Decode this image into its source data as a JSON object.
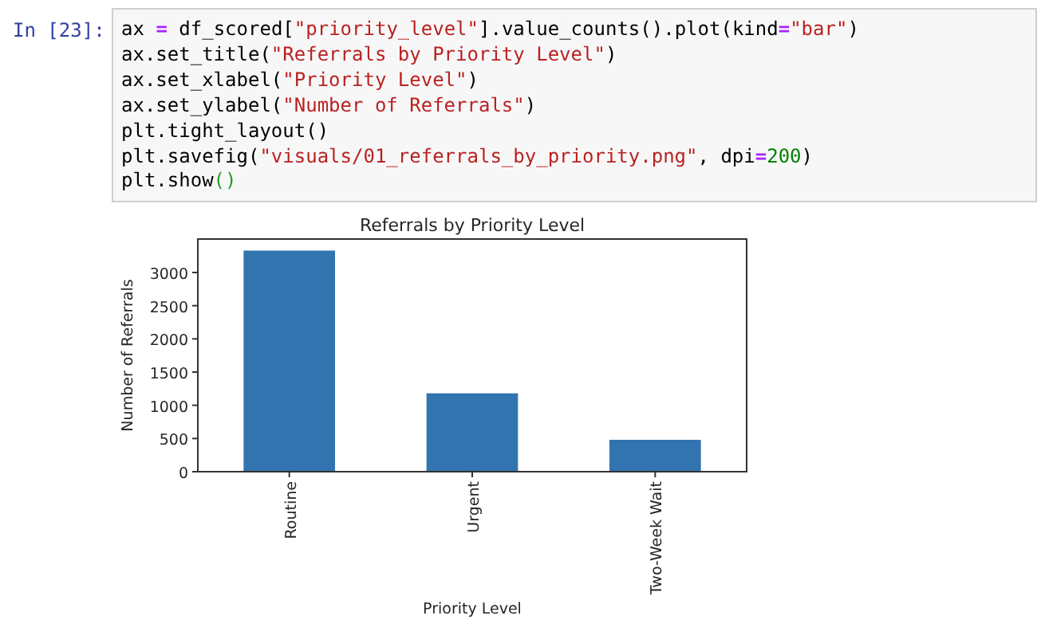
{
  "cell": {
    "prompt": "In [23]:",
    "code": [
      [
        {
          "kind": "plain",
          "text": "ax "
        },
        {
          "kind": "op",
          "text": "="
        },
        {
          "kind": "plain",
          "text": " df_scored["
        },
        {
          "kind": "str",
          "text": "\"priority_level\""
        },
        {
          "kind": "plain",
          "text": "].value_counts().plot(kind"
        },
        {
          "kind": "op",
          "text": "="
        },
        {
          "kind": "str",
          "text": "\"bar\""
        },
        {
          "kind": "plain",
          "text": ")"
        }
      ],
      [
        {
          "kind": "plain",
          "text": "ax.set_title("
        },
        {
          "kind": "str",
          "text": "\"Referrals by Priority Level\""
        },
        {
          "kind": "plain",
          "text": ")"
        }
      ],
      [
        {
          "kind": "plain",
          "text": "ax.set_xlabel("
        },
        {
          "kind": "str",
          "text": "\"Priority Level\""
        },
        {
          "kind": "plain",
          "text": ")"
        }
      ],
      [
        {
          "kind": "plain",
          "text": "ax.set_ylabel("
        },
        {
          "kind": "str",
          "text": "\"Number of Referrals\""
        },
        {
          "kind": "plain",
          "text": ")"
        }
      ],
      [
        {
          "kind": "plain",
          "text": "plt.tight_layout()"
        }
      ],
      [
        {
          "kind": "plain",
          "text": "plt.savefig("
        },
        {
          "kind": "str",
          "text": "\"visuals/01_referrals_by_priority.png\""
        },
        {
          "kind": "plain",
          "text": ", dpi"
        },
        {
          "kind": "op",
          "text": "="
        },
        {
          "kind": "num",
          "text": "200"
        },
        {
          "kind": "plain",
          "text": ")"
        }
      ],
      [
        {
          "kind": "plain",
          "text": "plt.show"
        },
        {
          "kind": "paren",
          "text": "()"
        }
      ]
    ]
  },
  "output": {
    "chart_data": {
      "type": "bar",
      "title": "Referrals by Priority Level",
      "xlabel": "Priority Level",
      "ylabel": "Number of Referrals",
      "categories": [
        "Routine",
        "Urgent",
        "Two-Week Wait"
      ],
      "series": [
        {
          "color": "#3274b0",
          "values": [
            3330,
            1180,
            480
          ]
        }
      ],
      "ylim": [
        0,
        3504
      ],
      "yticks": [
        0,
        500,
        1000,
        1500,
        2000,
        2500,
        3000
      ]
    }
  }
}
